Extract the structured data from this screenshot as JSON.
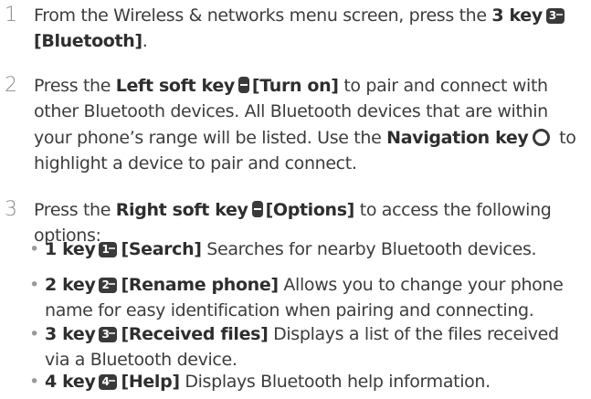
{
  "steps": [
    {
      "num": "1",
      "t1": "From the Wireless & networks menu screen, press the ",
      "b1": "3 key",
      "key_icon": "key-3-def-icon",
      "key_digit": "3",
      "b2": "[Bluetooth]",
      "t2": "."
    },
    {
      "num": "2",
      "t1": "Press the ",
      "b1": "Left soft key",
      "key_icon": "left-soft-key-icon",
      "b2": "[Turn on]",
      "t2": " to pair and connect with other Bluetooth devices. All Bluetooth devices that are within your phone’s range will be listed. Use the ",
      "b3": "Navigation key",
      "key_icon2": "navigation-key-icon",
      "t3": " to highlight a device to pair and connect."
    },
    {
      "num": "3",
      "t1": "Press the ",
      "b1": "Right soft key",
      "key_icon": "right-soft-key-icon",
      "b2": "[Options]",
      "t2": " to access the following options:"
    }
  ],
  "options": [
    {
      "key": "1 key",
      "digit": "1",
      "icon": "key-1-icon",
      "label": "[Search]",
      "desc": " Searches for nearby Bluetooth devices."
    },
    {
      "key": "2 key",
      "digit": "2",
      "icon": "key-2-abc-icon",
      "label": "[Rename phone]",
      "desc": " Allows you to change your phone name for easy identification when pairing and connecting."
    },
    {
      "key": "3 key",
      "digit": "3",
      "icon": "key-3-def-icon",
      "label": "[Received files]",
      "desc": " Displays a list of the files received via a Bluetooth device."
    },
    {
      "key": "4 key",
      "digit": "4",
      "icon": "key-4-ghi-icon",
      "label": "[Help]",
      "desc": " Displays Bluetooth help information."
    }
  ]
}
